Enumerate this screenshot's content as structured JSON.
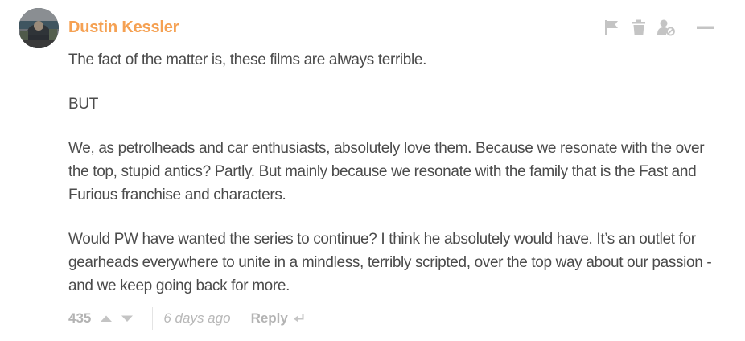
{
  "comment": {
    "author": "Dustin Kessler",
    "author_color": "#f5a153",
    "paragraphs": [
      "The fact of the matter is, these films are always terrible.",
      "BUT",
      "We, as petrolheads and car enthusiasts, absolutely love them. Because we resonate with the over the top, stupid antics? Partly. But mainly because we resonate with the family that is the Fast and Furious franchise and characters.",
      "Would PW have wanted the series to continue? I think he absolutely would have. It’s an outlet for gearheads everywhere to unite in a mindless, terribly scripted, over the top way about our passion - and we keep going back for more."
    ],
    "actions": {
      "flag_icon": "flag-icon",
      "delete_icon": "trash-icon",
      "block_icon": "block-user-icon",
      "collapse_icon": "minus-icon"
    },
    "footer": {
      "vote_count": "435",
      "upvote_icon": "triangle-up-icon",
      "downvote_icon": "triangle-down-icon",
      "timestamp": "6 days ago",
      "reply_label": "Reply",
      "reply_icon": "reply-arrow-icon"
    }
  }
}
